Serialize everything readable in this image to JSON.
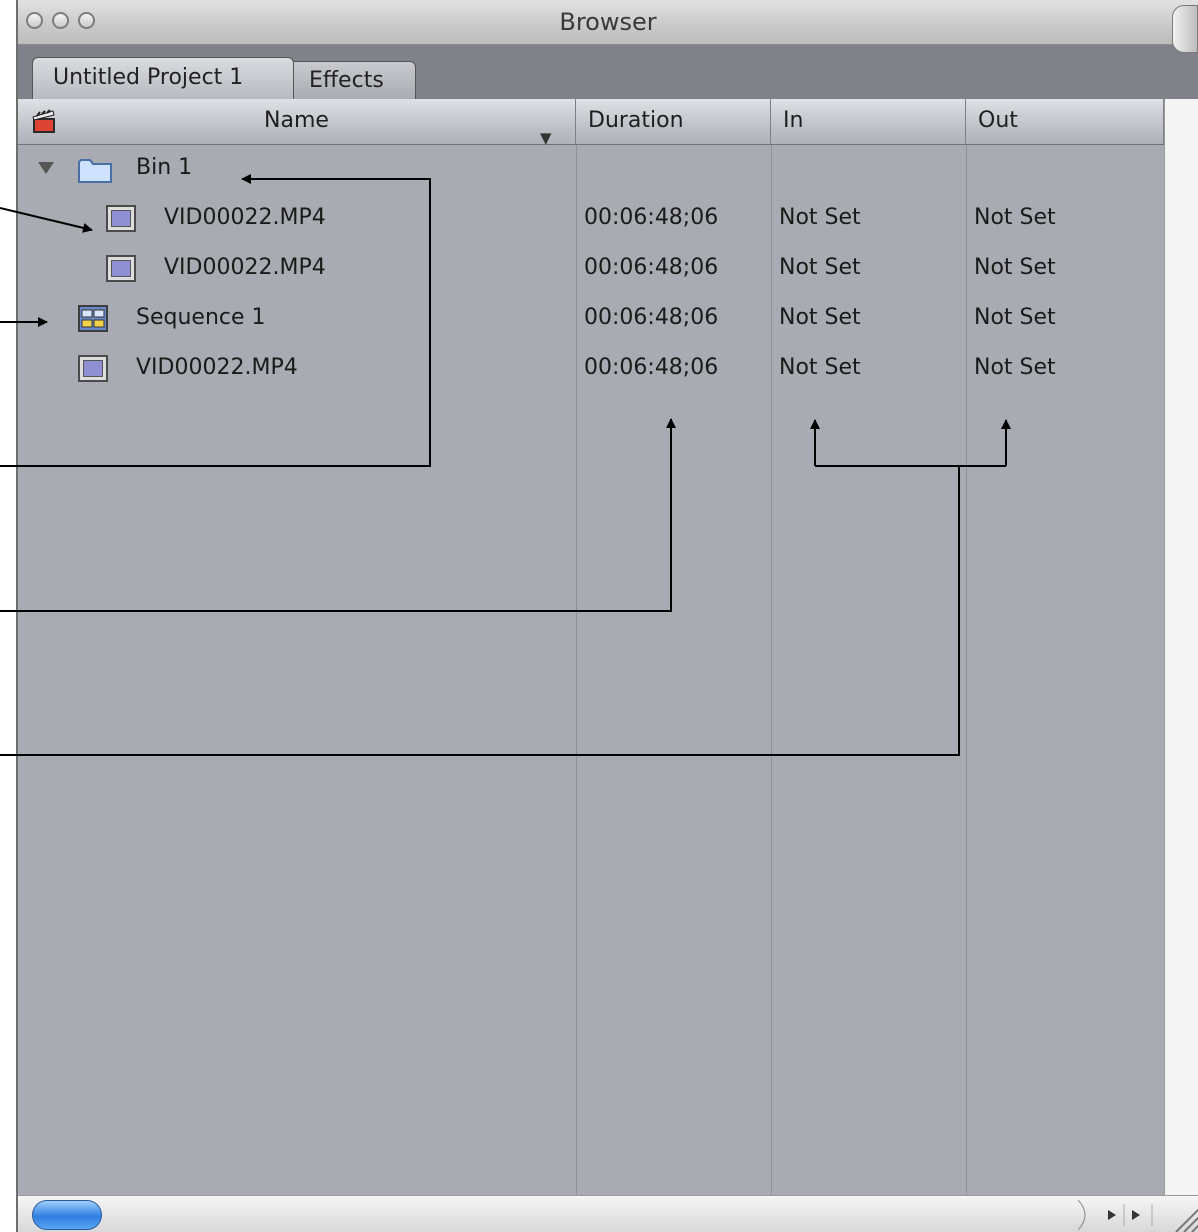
{
  "window": {
    "title": "Browser"
  },
  "tabs": [
    {
      "label": "Untitled Project 1"
    },
    {
      "label": "Effects"
    }
  ],
  "columns": {
    "name": "Name",
    "duration": "Duration",
    "in": "In",
    "out": "Out"
  },
  "rows": [
    {
      "name": "Bin 1",
      "type": "bin",
      "duration": "",
      "in": "",
      "out": ""
    },
    {
      "name": "VID00022.MP4",
      "type": "clip",
      "duration": "00:06:48;06",
      "in": "Not Set",
      "out": "Not Set"
    },
    {
      "name": "VID00022.MP4",
      "type": "clip",
      "duration": "00:06:48;06",
      "in": "Not Set",
      "out": "Not Set"
    },
    {
      "name": "Sequence 1",
      "type": "sequence",
      "duration": "00:06:48;06",
      "in": "Not Set",
      "out": "Not Set"
    },
    {
      "name": "VID00022.MP4",
      "type": "clip",
      "duration": "00:06:48;06",
      "in": "Not Set",
      "out": "Not Set"
    }
  ],
  "colors": {
    "list_bg": "#a8abb2",
    "header_bg": "#c2c5cb",
    "scroll_thumb": "#2f7fe0"
  }
}
